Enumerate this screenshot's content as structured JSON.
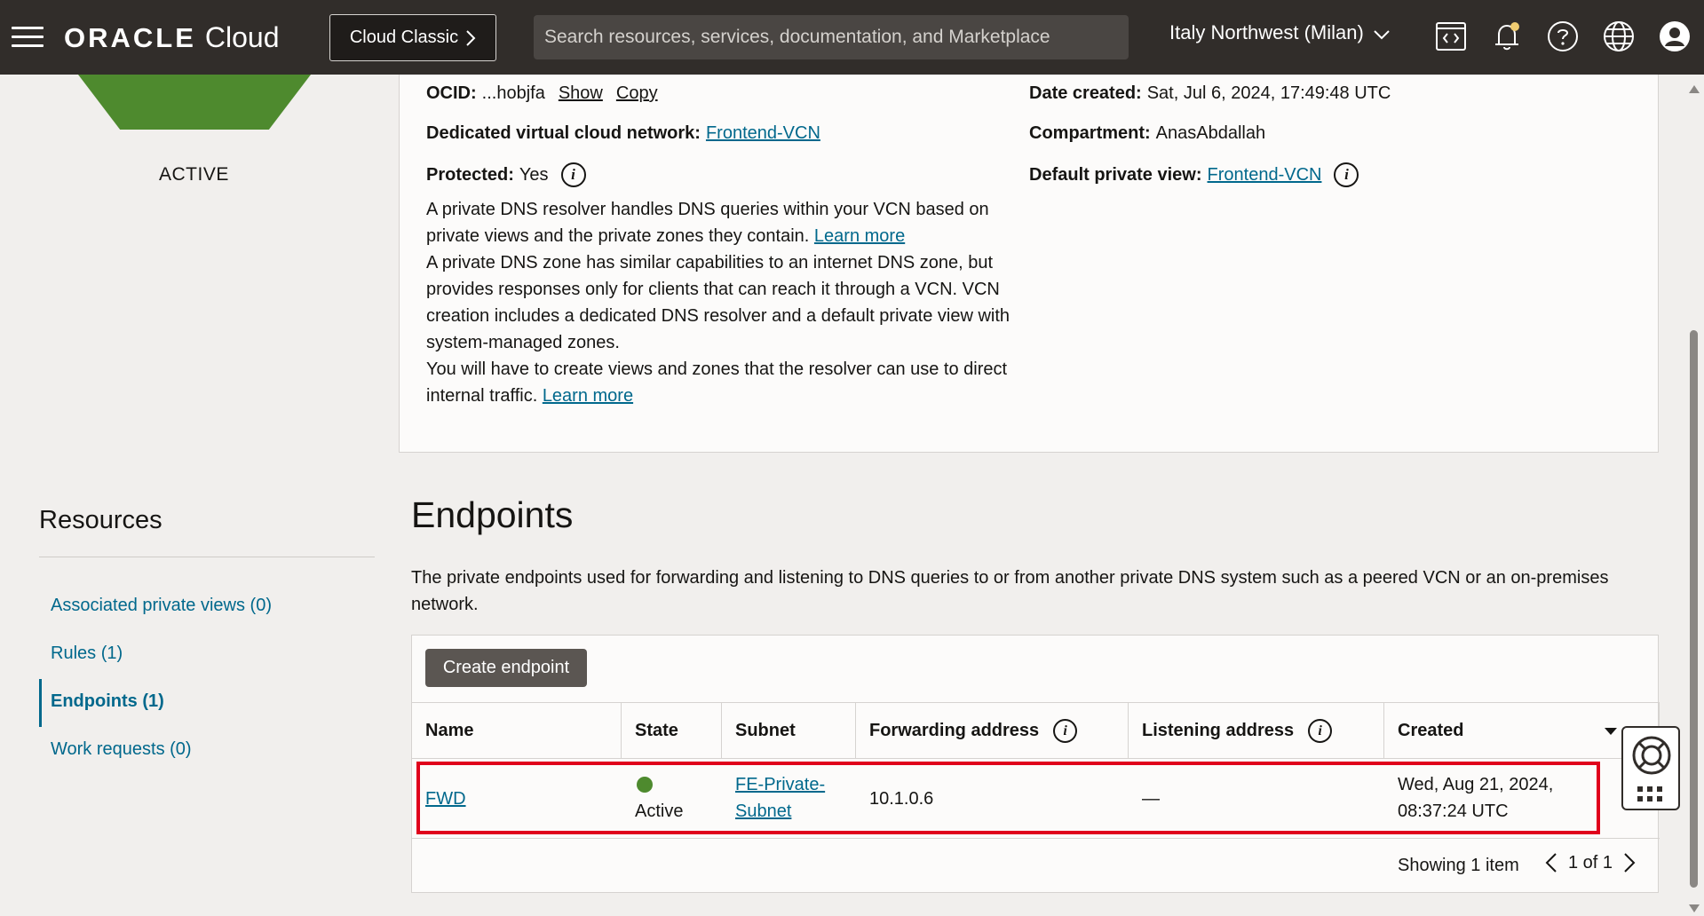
{
  "topbar": {
    "brand_oracle": "ORACLE",
    "brand_cloud": "Cloud",
    "classic_label": "Cloud Classic",
    "search_placeholder": "Search resources, services, documentation, and Marketplace",
    "region": "Italy Northwest (Milan)",
    "icons": [
      "hamburger-menu-icon",
      "code-editor-icon",
      "notifications-bell-icon",
      "help-question-icon",
      "language-globe-icon",
      "user-profile-icon"
    ]
  },
  "resolver": {
    "status": "ACTIVE",
    "ocid_label": "OCID:",
    "ocid_value": "...hobjfa",
    "show_label": "Show",
    "copy_label": "Copy",
    "date_label": "Date created:",
    "date_value": "Sat, Jul 6, 2024, 17:49:48 UTC",
    "vcn_label": "Dedicated virtual cloud network:",
    "vcn_value": "Frontend-VCN",
    "compartment_label": "Compartment:",
    "compartment_value": "AnasAbdallah",
    "protected_label": "Protected:",
    "protected_value": "Yes",
    "default_view_label": "Default private view:",
    "default_view_value": "Frontend-VCN",
    "desc_p1": "A private DNS resolver handles DNS queries within your VCN based on private views and the private zones they contain.",
    "desc_p2": "A private DNS zone has similar capabilities to an internet DNS zone, but provides responses only for clients that can reach it through a VCN. VCN creation includes a dedicated DNS resolver and a default private view with system-managed zones.",
    "desc_p3": "You will have to create views and zones that the resolver can use to direct internal traffic.",
    "learn_more": "Learn more"
  },
  "resources": {
    "title": "Resources",
    "items": [
      {
        "label": "Associated private views (0)"
      },
      {
        "label": "Rules (1)"
      },
      {
        "label": "Endpoints (1)"
      },
      {
        "label": "Work requests (0)"
      }
    ]
  },
  "endpoints": {
    "title": "Endpoints",
    "description": "The private endpoints used for forwarding and listening to DNS queries to or from another private DNS system such as a peered VCN or an on-premises network.",
    "create_label": "Create endpoint",
    "columns": [
      "Name",
      "State",
      "Subnet",
      "Forwarding address",
      "Listening address",
      "Created"
    ],
    "rows": [
      {
        "name": "FWD",
        "state": "Active",
        "subnet_line1": "FE-Private-",
        "subnet_line2": "Subnet",
        "forwarding": "10.1.0.6",
        "listening": "—",
        "created_line1": "Wed, Aug 21, 2024,",
        "created_line2": "08:37:24 UTC"
      }
    ],
    "showing": "Showing 1 item",
    "page": "1 of 1"
  },
  "colors": {
    "accent_link": "#00688c",
    "active_green": "#4e8a2e",
    "highlight_red": "#e0001b",
    "topbar_bg": "#312d2a"
  }
}
